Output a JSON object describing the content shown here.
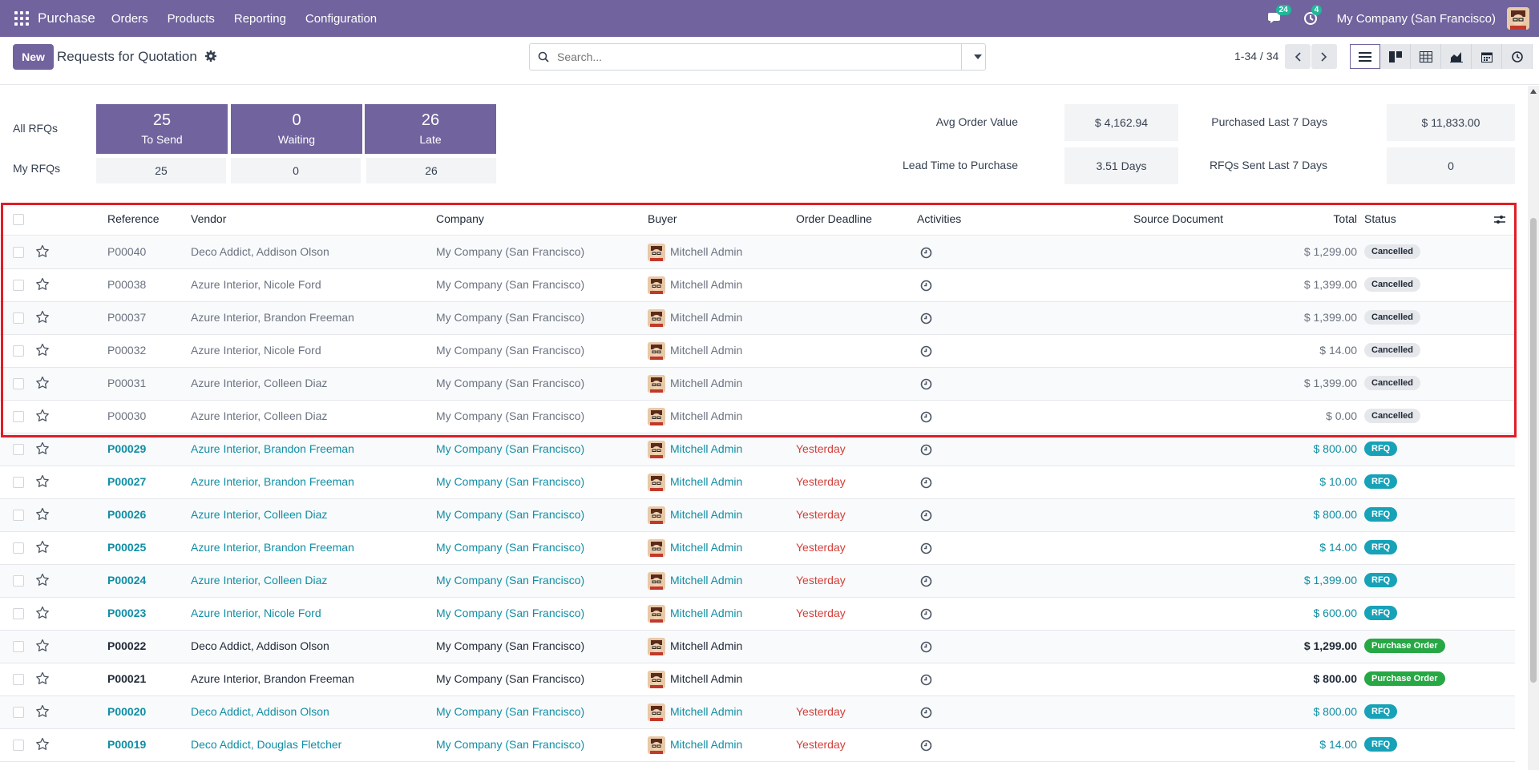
{
  "navbar": {
    "app_name": "Purchase",
    "menu": [
      "Orders",
      "Products",
      "Reporting",
      "Configuration"
    ],
    "messages_count": "24",
    "activities_count": "4",
    "company": "My Company (San Francisco)"
  },
  "control": {
    "new_label": "New",
    "title": "Requests for Quotation",
    "search_placeholder": "Search...",
    "pager": "1-34 / 34"
  },
  "dashboard": {
    "all_rfqs_label": "All RFQs",
    "my_rfqs_label": "My RFQs",
    "tiles": [
      {
        "num": "25",
        "label": "To Send",
        "mine": "25"
      },
      {
        "num": "0",
        "label": "Waiting",
        "mine": "0"
      },
      {
        "num": "26",
        "label": "Late",
        "mine": "26"
      }
    ],
    "kpis": [
      {
        "label": "Avg Order Value",
        "value": "$ 4,162.94"
      },
      {
        "label": "Purchased Last 7 Days",
        "value": "$ 11,833.00"
      },
      {
        "label": "Lead Time to Purchase",
        "value": "3.51 Days"
      },
      {
        "label": "RFQs Sent Last 7 Days",
        "value": "0"
      }
    ]
  },
  "table": {
    "headers": [
      "Reference",
      "Vendor",
      "Company",
      "Buyer",
      "Order Deadline",
      "Activities",
      "Source Document",
      "Total",
      "Status"
    ],
    "rows": [
      {
        "ref": "P00040",
        "vendor": "Deco Addict, Addison Olson",
        "company": "My Company (San Francisco)",
        "buyer": "Mitchell Admin",
        "deadline": "",
        "total": "$ 1,299.00",
        "status": "Cancelled",
        "kind": "cancelled"
      },
      {
        "ref": "P00038",
        "vendor": "Azure Interior, Nicole Ford",
        "company": "My Company (San Francisco)",
        "buyer": "Mitchell Admin",
        "deadline": "",
        "total": "$ 1,399.00",
        "status": "Cancelled",
        "kind": "cancelled"
      },
      {
        "ref": "P00037",
        "vendor": "Azure Interior, Brandon Freeman",
        "company": "My Company (San Francisco)",
        "buyer": "Mitchell Admin",
        "deadline": "",
        "total": "$ 1,399.00",
        "status": "Cancelled",
        "kind": "cancelled"
      },
      {
        "ref": "P00032",
        "vendor": "Azure Interior, Nicole Ford",
        "company": "My Company (San Francisco)",
        "buyer": "Mitchell Admin",
        "deadline": "",
        "total": "$ 14.00",
        "status": "Cancelled",
        "kind": "cancelled"
      },
      {
        "ref": "P00031",
        "vendor": "Azure Interior, Colleen Diaz",
        "company": "My Company (San Francisco)",
        "buyer": "Mitchell Admin",
        "deadline": "",
        "total": "$ 1,399.00",
        "status": "Cancelled",
        "kind": "cancelled"
      },
      {
        "ref": "P00030",
        "vendor": "Azure Interior, Colleen Diaz",
        "company": "My Company (San Francisco)",
        "buyer": "Mitchell Admin",
        "deadline": "",
        "total": "$ 0.00",
        "status": "Cancelled",
        "kind": "cancelled"
      },
      {
        "ref": "P00029",
        "vendor": "Azure Interior, Brandon Freeman",
        "company": "My Company (San Francisco)",
        "buyer": "Mitchell Admin",
        "deadline": "Yesterday",
        "total": "$ 800.00",
        "status": "RFQ",
        "kind": "rfq"
      },
      {
        "ref": "P00027",
        "vendor": "Azure Interior, Brandon Freeman",
        "company": "My Company (San Francisco)",
        "buyer": "Mitchell Admin",
        "deadline": "Yesterday",
        "total": "$ 10.00",
        "status": "RFQ",
        "kind": "rfq"
      },
      {
        "ref": "P00026",
        "vendor": "Azure Interior, Colleen Diaz",
        "company": "My Company (San Francisco)",
        "buyer": "Mitchell Admin",
        "deadline": "Yesterday",
        "total": "$ 800.00",
        "status": "RFQ",
        "kind": "rfq"
      },
      {
        "ref": "P00025",
        "vendor": "Azure Interior, Brandon Freeman",
        "company": "My Company (San Francisco)",
        "buyer": "Mitchell Admin",
        "deadline": "Yesterday",
        "total": "$ 14.00",
        "status": "RFQ",
        "kind": "rfq"
      },
      {
        "ref": "P00024",
        "vendor": "Azure Interior, Colleen Diaz",
        "company": "My Company (San Francisco)",
        "buyer": "Mitchell Admin",
        "deadline": "Yesterday",
        "total": "$ 1,399.00",
        "status": "RFQ",
        "kind": "rfq"
      },
      {
        "ref": "P00023",
        "vendor": "Azure Interior, Nicole Ford",
        "company": "My Company (San Francisco)",
        "buyer": "Mitchell Admin",
        "deadline": "Yesterday",
        "total": "$ 600.00",
        "status": "RFQ",
        "kind": "rfq"
      },
      {
        "ref": "P00022",
        "vendor": "Deco Addict, Addison Olson",
        "company": "My Company (San Francisco)",
        "buyer": "Mitchell Admin",
        "deadline": "",
        "total": "$ 1,299.00",
        "status": "Purchase Order",
        "kind": "po"
      },
      {
        "ref": "P00021",
        "vendor": "Azure Interior, Brandon Freeman",
        "company": "My Company (San Francisco)",
        "buyer": "Mitchell Admin",
        "deadline": "",
        "total": "$ 800.00",
        "status": "Purchase Order",
        "kind": "po"
      },
      {
        "ref": "P00020",
        "vendor": "Deco Addict, Addison Olson",
        "company": "My Company (San Francisco)",
        "buyer": "Mitchell Admin",
        "deadline": "Yesterday",
        "total": "$ 800.00",
        "status": "RFQ",
        "kind": "rfq"
      },
      {
        "ref": "P00019",
        "vendor": "Deco Addict, Douglas Fletcher",
        "company": "My Company (San Francisco)",
        "buyer": "Mitchell Admin",
        "deadline": "Yesterday",
        "total": "$ 14.00",
        "status": "RFQ",
        "kind": "rfq"
      }
    ]
  },
  "colors": {
    "brand": "#71639e",
    "link": "#0f8ea5",
    "late": "#d23f3a",
    "rfq_badge": "#17a2b8",
    "po_badge": "#28a745",
    "highlight": "#e11d26"
  }
}
